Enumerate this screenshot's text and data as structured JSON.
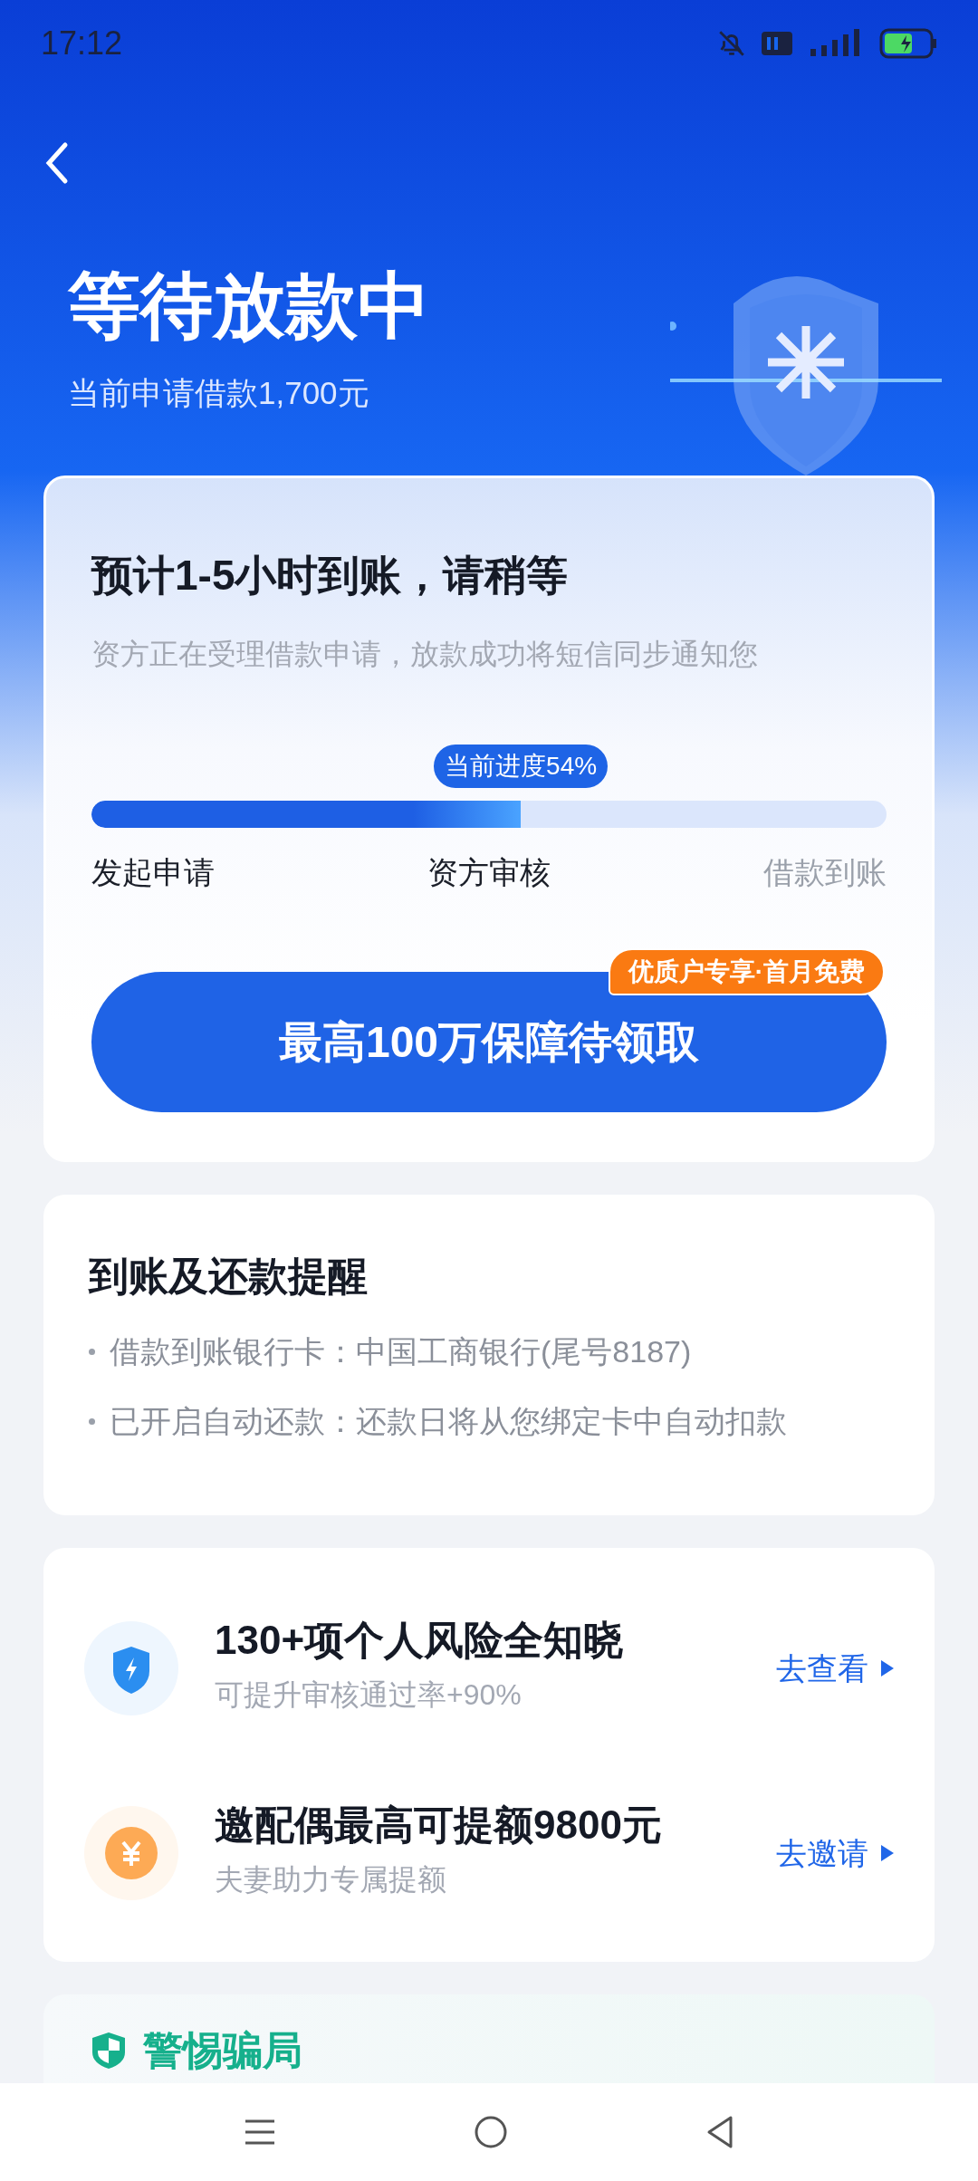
{
  "status_bar": {
    "time": "17:12"
  },
  "header": {
    "title": "等待放款中",
    "subtitle": "当前申请借款1,700元"
  },
  "progress_card": {
    "heading": "预计1-5小时到账，请稍等",
    "description": "资方正在受理借款申请，放款成功将短信同步通知您",
    "progress": {
      "label": "当前进度54%",
      "level": 0.54
    },
    "steps": [
      {
        "label": "发起申请",
        "reached": true
      },
      {
        "label": "资方审核",
        "reached": true
      },
      {
        "label": "借款到账",
        "reached": false
      }
    ],
    "button": {
      "label": "最高100万保障待领取",
      "badge": "优质户专享·首月免费"
    }
  },
  "reminder_card": {
    "title": "到账及还款提醒",
    "items": [
      "借款到账银行卡：中国工商银行(尾号8187)",
      "已开启自动还款：还款日将从您绑定卡中自动扣款"
    ]
  },
  "offers": [
    {
      "kind": "shield",
      "title": "130+项个人风险全知晓",
      "subtitle": "可提升审核通过率+90%",
      "action": "去查看"
    },
    {
      "kind": "coin",
      "title": "邀配偶最高可提额9800元",
      "subtitle": "夫妻助力专属提额",
      "action": "去邀请"
    }
  ],
  "warning_card": {
    "title": "警惕骗局"
  }
}
